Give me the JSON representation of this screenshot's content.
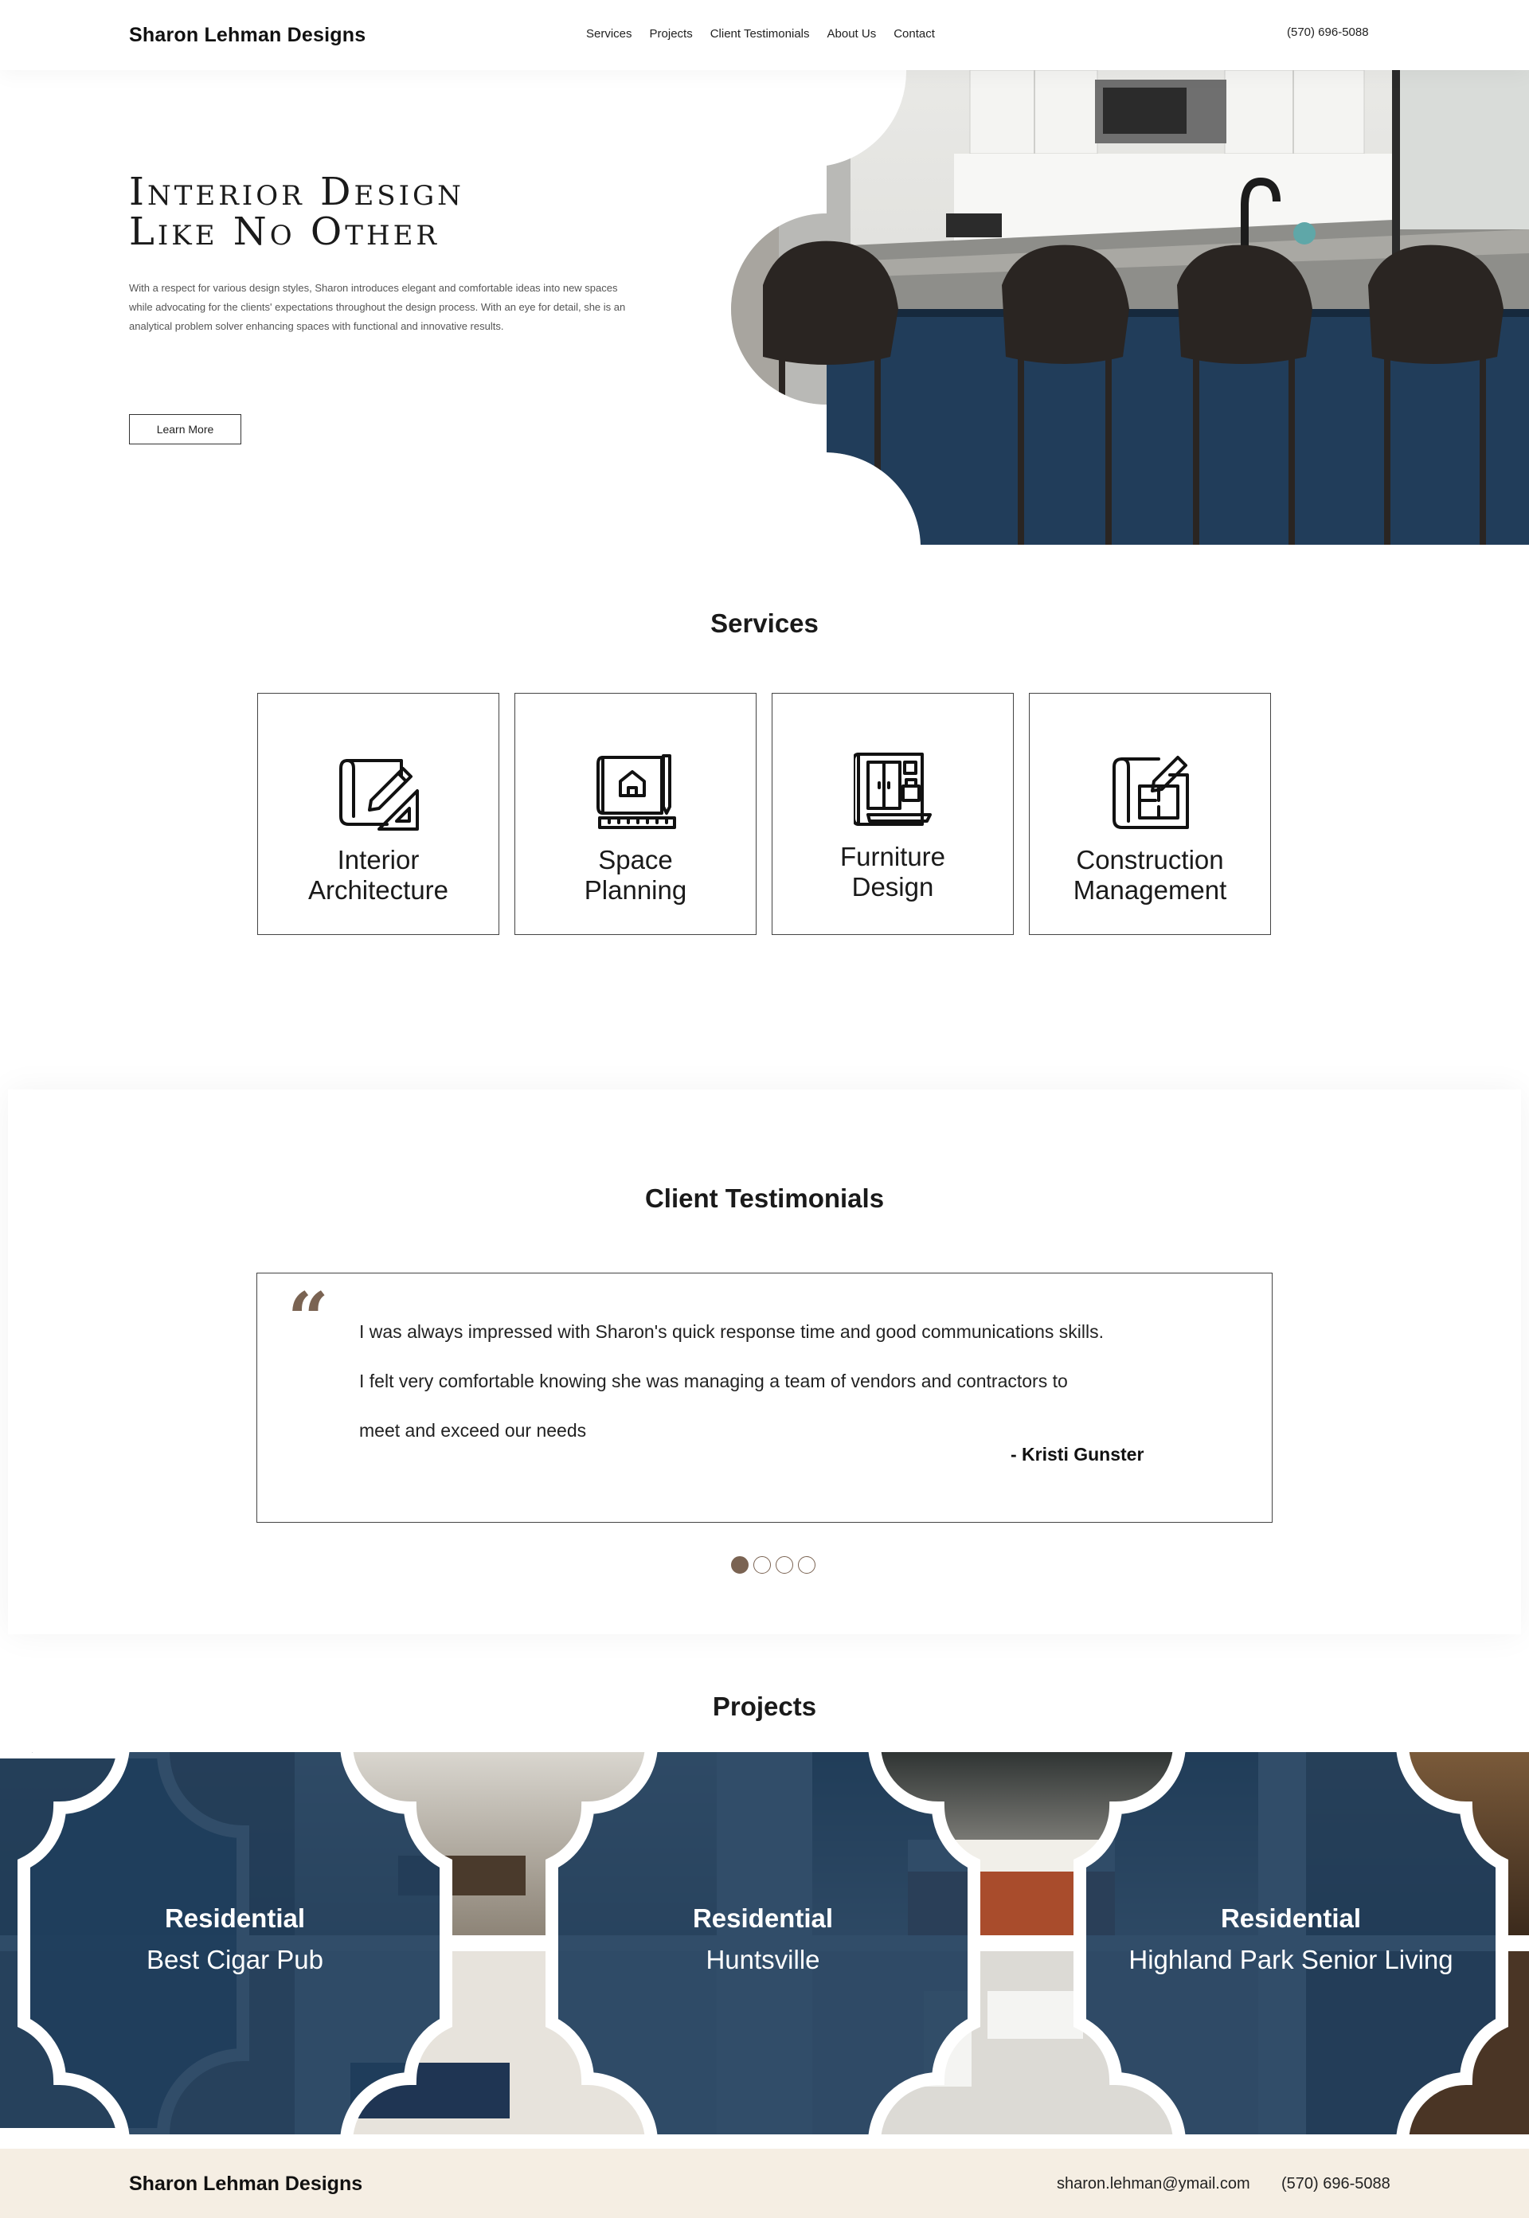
{
  "header": {
    "brand": "Sharon Lehman Designs",
    "nav": [
      "Services",
      "Projects",
      "Client Testimonials",
      "About Us",
      "Contact"
    ],
    "phone": "(570) 696-5088"
  },
  "hero": {
    "title_line1": "Interior Design",
    "title_line2": "Like No Other",
    "text": "With a respect for various design styles, Sharon introduces elegant and comfortable ideas into new spaces while advocating for the clients' expectations throughout the design process. With an eye for detail, she is an analytical problem solver enhancing spaces with functional and innovative results.",
    "button": "Learn More"
  },
  "services": {
    "title": "Services",
    "items": [
      {
        "line1": "Interior",
        "line2": "Architecture",
        "icon": "blueprint-pencil-icon"
      },
      {
        "line1": "Space",
        "line2": "Planning",
        "icon": "house-plan-icon"
      },
      {
        "line1": "Furniture",
        "line2": "Design",
        "icon": "cabinet-icon"
      },
      {
        "line1": "Construction",
        "line2": "Management",
        "icon": "floor-plan-icon"
      }
    ]
  },
  "testimonials": {
    "title": "Client Testimonials",
    "quote_mark": "“",
    "lines": [
      "I was always impressed with Sharon's quick response time and good communications skills.",
      "I felt very comfortable knowing she was managing a team of vendors and contractors to",
      "meet and exceed our needs"
    ],
    "author": "-  Kristi Gunster",
    "active_slide": 1,
    "slide_count": 4
  },
  "projects": {
    "title": "Projects",
    "items": [
      {
        "category": "Residential",
        "name": "Best Cigar Pub"
      },
      {
        "category": "Residential",
        "name": "Huntsville"
      },
      {
        "category": "Residential",
        "name": "Highland Park Senior Living"
      }
    ]
  },
  "footer": {
    "brand": "Sharon Lehman Designs",
    "email": "sharon.lehman@ymail.com",
    "phone": "(570) 696-5088"
  },
  "colors": {
    "accent": "#7a6352",
    "footer_bg": "#f5eee3",
    "overlay_blue": "#1f3e5c"
  }
}
